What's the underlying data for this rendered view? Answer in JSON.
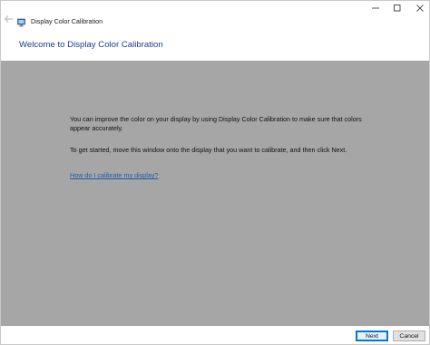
{
  "window": {
    "title": "Display Color Calibration",
    "controls": {
      "minimize_icon": "minimize-icon",
      "maximize_icon": "maximize-icon",
      "close_icon": "close-icon"
    },
    "back_icon": "back-arrow-icon",
    "app_icon": "display-calibration-app-icon"
  },
  "header": {
    "title": "Welcome to Display Color Calibration"
  },
  "content": {
    "paragraph_1": "You can improve the color on your display by using Display Color Calibration to make sure that colors appear accurately.",
    "paragraph_2": "To get started, move this window onto the display that you want to calibrate, and then click Next.",
    "help_link": "How do I calibrate my display?"
  },
  "footer": {
    "next_label": "Next",
    "cancel_label": "Cancel"
  },
  "colors": {
    "content_background": "#a6a6a6",
    "header_title": "#1a3e8f",
    "link": "#1e5aa8",
    "default_button_border": "#0078d7"
  }
}
